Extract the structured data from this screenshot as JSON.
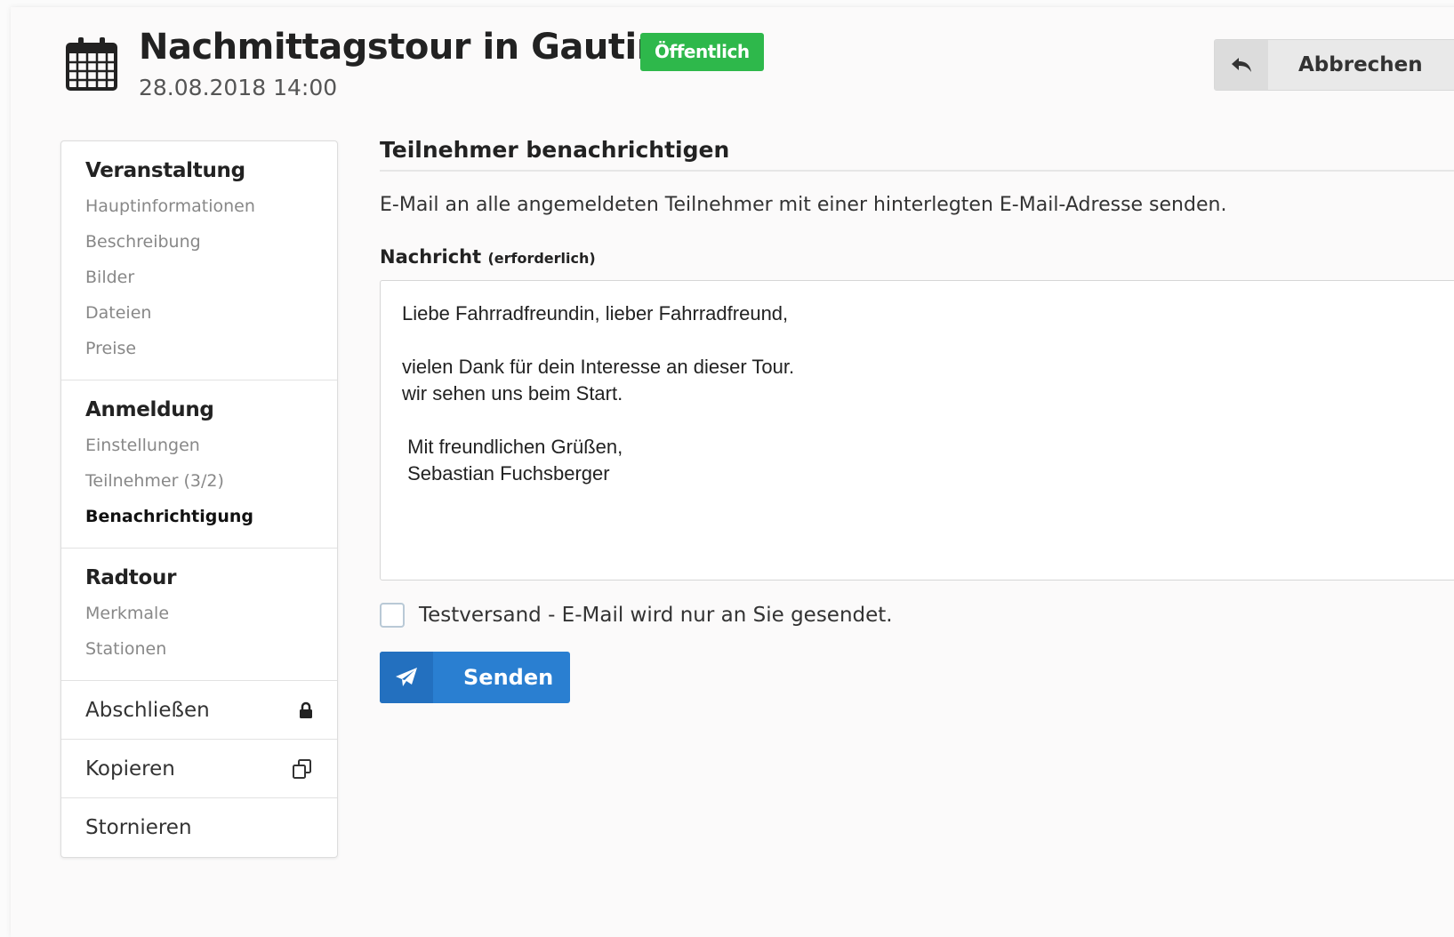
{
  "header": {
    "title": "Nachmittagstour in Gauting",
    "badge": "Öffentlich",
    "datetime": "28.08.2018 14:00",
    "cancel_label": "Abbrechen",
    "colors": {
      "badge": "#2eb84b",
      "primary": "#2a7fd1"
    }
  },
  "sidebar": {
    "sections": [
      {
        "title": "Veranstaltung",
        "items": [
          "Hauptinformationen",
          "Beschreibung",
          "Bilder",
          "Dateien",
          "Preise"
        ]
      },
      {
        "title": "Anmeldung",
        "items": [
          "Einstellungen",
          "Teilnehmer (3/2)",
          "Benachrichtigung"
        ],
        "active": "Benachrichtigung"
      },
      {
        "title": "Radtour",
        "items": [
          "Merkmale",
          "Stationen"
        ]
      }
    ],
    "actions": [
      {
        "label": "Abschließen",
        "icon": "lock-icon"
      },
      {
        "label": "Kopieren",
        "icon": "copy-icon"
      },
      {
        "label": "Stornieren",
        "icon": ""
      }
    ]
  },
  "main": {
    "title": "Teilnehmer benachrichtigen",
    "description": "E-Mail an alle angemeldeten Teilnehmer mit einer hinterlegten E-Mail-Adresse senden.",
    "message_label": "Nachricht",
    "message_required": "(erforderlich)",
    "message_text": "Liebe Fahrradfreundin, lieber Fahrradfreund,\n\nvielen Dank für dein Interesse an dieser Tour.\nwir sehen uns beim Start.\n\n Mit freundlichen Grüßen,\n Sebastian Fuchsberger",
    "test_checkbox": {
      "label": "Testversand - E-Mail wird nur an Sie gesendet.",
      "checked": false
    },
    "send_label": "Senden"
  }
}
